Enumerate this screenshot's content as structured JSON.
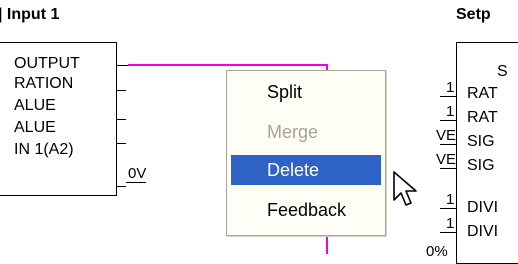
{
  "left_block": {
    "title": "| Input 1",
    "ports": [
      "OUTPUT",
      "RATION",
      "ALUE",
      "ALUE",
      "IN 1(A2)"
    ],
    "value": "0V"
  },
  "right_block": {
    "title": "Setp",
    "partial_label": "S",
    "ports": [
      "RAT",
      "RAT",
      "SIG",
      "SIG",
      "DIVI",
      "DIVI"
    ],
    "marks": [
      "1",
      "1",
      "VE",
      "VE",
      "1",
      "1",
      "0%"
    ]
  },
  "context_menu": {
    "items": [
      {
        "label": "Split",
        "state": "normal"
      },
      {
        "label": "Merge",
        "state": "disabled"
      },
      {
        "label": "Delete",
        "state": "highlighted"
      },
      {
        "label": "Feedback",
        "state": "normal"
      }
    ],
    "highlight_color": "#2e62c4"
  },
  "wire_color": "#ee00ee",
  "cursor": "arrow-cursor-icon"
}
